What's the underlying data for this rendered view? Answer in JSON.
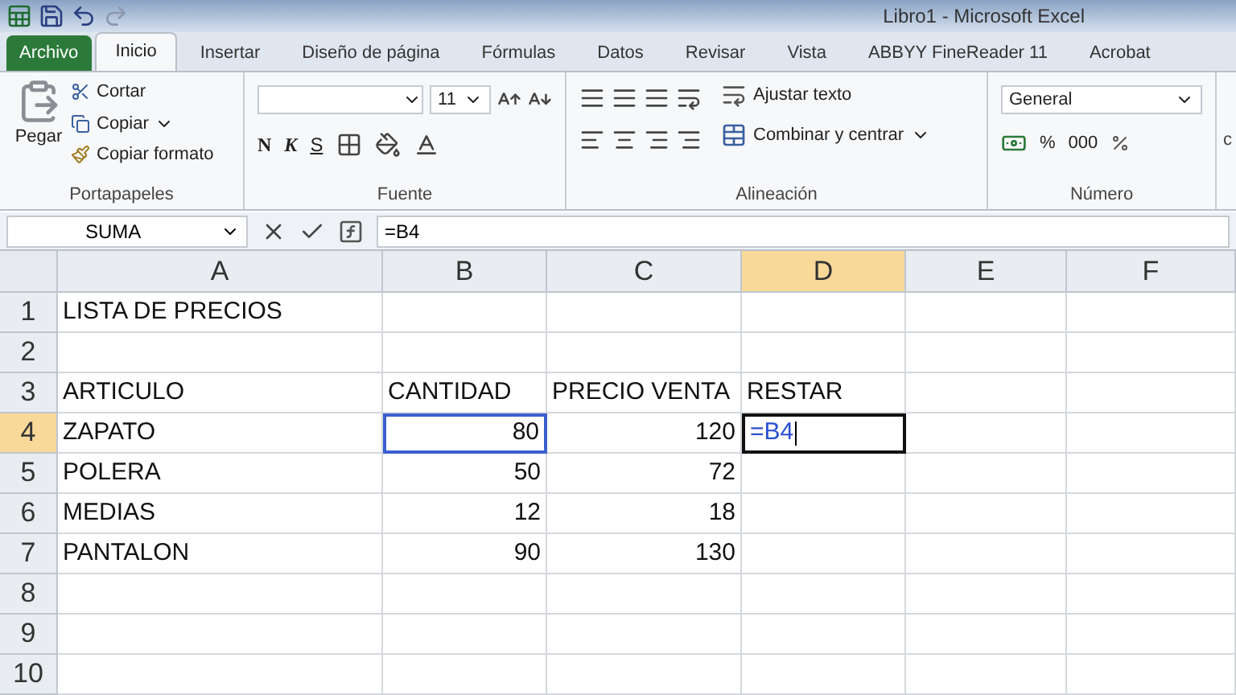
{
  "title_bar": {
    "title": "Libro1 - Microsoft Excel"
  },
  "tabs": [
    {
      "label": "Archivo",
      "kind": "file",
      "selected": false
    },
    {
      "label": "Inicio",
      "kind": "tab",
      "selected": true
    },
    {
      "label": "Insertar",
      "kind": "tab",
      "selected": false
    },
    {
      "label": "Diseño de página",
      "kind": "tab",
      "selected": false
    },
    {
      "label": "Fórmulas",
      "kind": "tab",
      "selected": false
    },
    {
      "label": "Datos",
      "kind": "tab",
      "selected": false
    },
    {
      "label": "Revisar",
      "kind": "tab",
      "selected": false
    },
    {
      "label": "Vista",
      "kind": "tab",
      "selected": false
    },
    {
      "label": "ABBYY FineReader 11",
      "kind": "tab",
      "selected": false
    },
    {
      "label": "Acrobat",
      "kind": "tab",
      "selected": false
    }
  ],
  "ribbon": {
    "clipboard": {
      "label": "Portapapeles",
      "paste": "Pegar",
      "cut": "Cortar",
      "copy": "Copiar",
      "format_painter": "Copiar formato"
    },
    "font": {
      "label": "Fuente",
      "size": "11",
      "bold": "N",
      "italic": "K",
      "underline": "S"
    },
    "alignment": {
      "label": "Alineación",
      "wrap": "Ajustar texto",
      "merge": "Combinar y centrar"
    },
    "number": {
      "label": "Número",
      "format": "General",
      "percent": "%",
      "thousands": "000"
    },
    "next_group": "c"
  },
  "formula_bar": {
    "name_box": "SUMA",
    "formula": "=B4"
  },
  "sheet": {
    "columns": [
      {
        "label": "A",
        "selected": false
      },
      {
        "label": "B",
        "selected": false
      },
      {
        "label": "C",
        "selected": false
      },
      {
        "label": "D",
        "selected": true
      },
      {
        "label": "E",
        "selected": false
      },
      {
        "label": "F",
        "selected": false
      }
    ],
    "rows": [
      {
        "number": "1",
        "selected": false,
        "cells": [
          {
            "value": "LISTA DE PRECIOS",
            "kind": "text"
          },
          {},
          {},
          {},
          {},
          {}
        ]
      },
      {
        "number": "2",
        "selected": false,
        "cells": [
          {},
          {},
          {},
          {},
          {},
          {}
        ]
      },
      {
        "number": "3",
        "selected": false,
        "cells": [
          {
            "value": "ARTICULO",
            "kind": "text"
          },
          {
            "value": "CANTIDAD",
            "kind": "text"
          },
          {
            "value": "PRECIO VENTA",
            "kind": "text"
          },
          {
            "value": "RESTAR",
            "kind": "text"
          },
          {},
          {}
        ]
      },
      {
        "number": "4",
        "selected": true,
        "cells": [
          {
            "value": "ZAPATO",
            "kind": "text",
            "active": false,
            "referenced": false
          },
          {
            "value": "80",
            "kind": "number",
            "active": false,
            "referenced": true
          },
          {
            "value": "120",
            "kind": "number",
            "active": false,
            "referenced": false
          },
          {
            "value": "=B4",
            "kind": "formula",
            "active": true,
            "referenced": false
          },
          {
            "active": false,
            "referenced": false
          },
          {
            "active": false,
            "referenced": false
          }
        ]
      },
      {
        "number": "5",
        "selected": false,
        "cells": [
          {
            "value": "POLERA",
            "kind": "text"
          },
          {
            "value": "50",
            "kind": "number"
          },
          {
            "value": "72",
            "kind": "number"
          },
          {},
          {},
          {}
        ]
      },
      {
        "number": "6",
        "selected": false,
        "cells": [
          {
            "value": "MEDIAS",
            "kind": "text"
          },
          {
            "value": "12",
            "kind": "number"
          },
          {
            "value": "18",
            "kind": "number"
          },
          {},
          {},
          {}
        ]
      },
      {
        "number": "7",
        "selected": false,
        "cells": [
          {
            "value": "PANTALON",
            "kind": "text"
          },
          {
            "value": "90",
            "kind": "number"
          },
          {
            "value": "130",
            "kind": "number"
          },
          {},
          {},
          {}
        ]
      },
      {
        "number": "8",
        "selected": false,
        "cells": [
          {},
          {},
          {},
          {},
          {},
          {}
        ]
      },
      {
        "number": "9",
        "selected": false,
        "cells": [
          {},
          {},
          {},
          {},
          {},
          {}
        ]
      },
      {
        "number": "10",
        "selected": false,
        "cells": [
          {},
          {},
          {},
          {},
          {},
          {}
        ]
      }
    ]
  }
}
